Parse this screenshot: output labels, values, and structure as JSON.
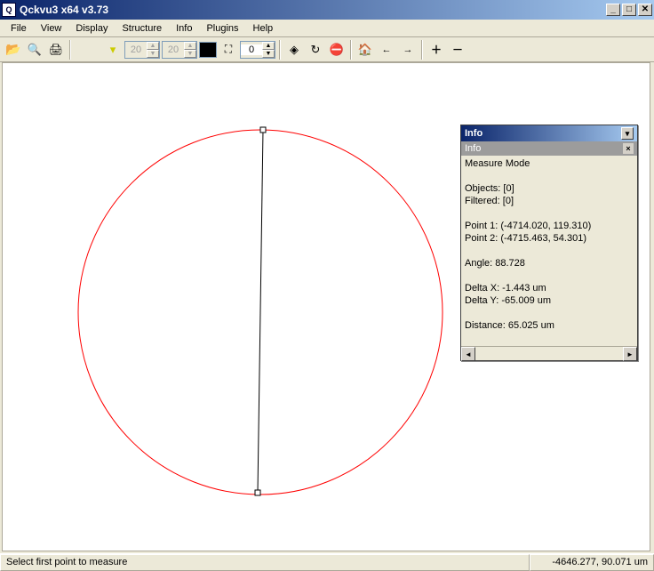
{
  "window": {
    "title": "Qckvu3 x64 v3.73",
    "icon_label": "Q"
  },
  "menu": {
    "file": "File",
    "view": "View",
    "display": "Display",
    "structure": "Structure",
    "info": "Info",
    "plugins": "Plugins",
    "help": "Help"
  },
  "toolbar": {
    "spinner1": "20",
    "spinner2": "20",
    "spinner3": "0"
  },
  "info_panel": {
    "title": "Info",
    "subtitle": "Info",
    "mode": "Measure Mode",
    "objects_label": "Objects: [0]",
    "filtered_label": "Filtered: [0]",
    "point1": "Point 1: (-4714.020, 119.310)",
    "point2": "Point 2: (-4715.463, 54.301)",
    "angle": "Angle: 88.728",
    "deltax": "Delta X: -1.443 um",
    "deltay": "Delta Y: -65.009 um",
    "distance": "Distance: 65.025 um"
  },
  "status": {
    "left": "Select first point to measure",
    "right": "-4646.277, 90.071 um"
  }
}
